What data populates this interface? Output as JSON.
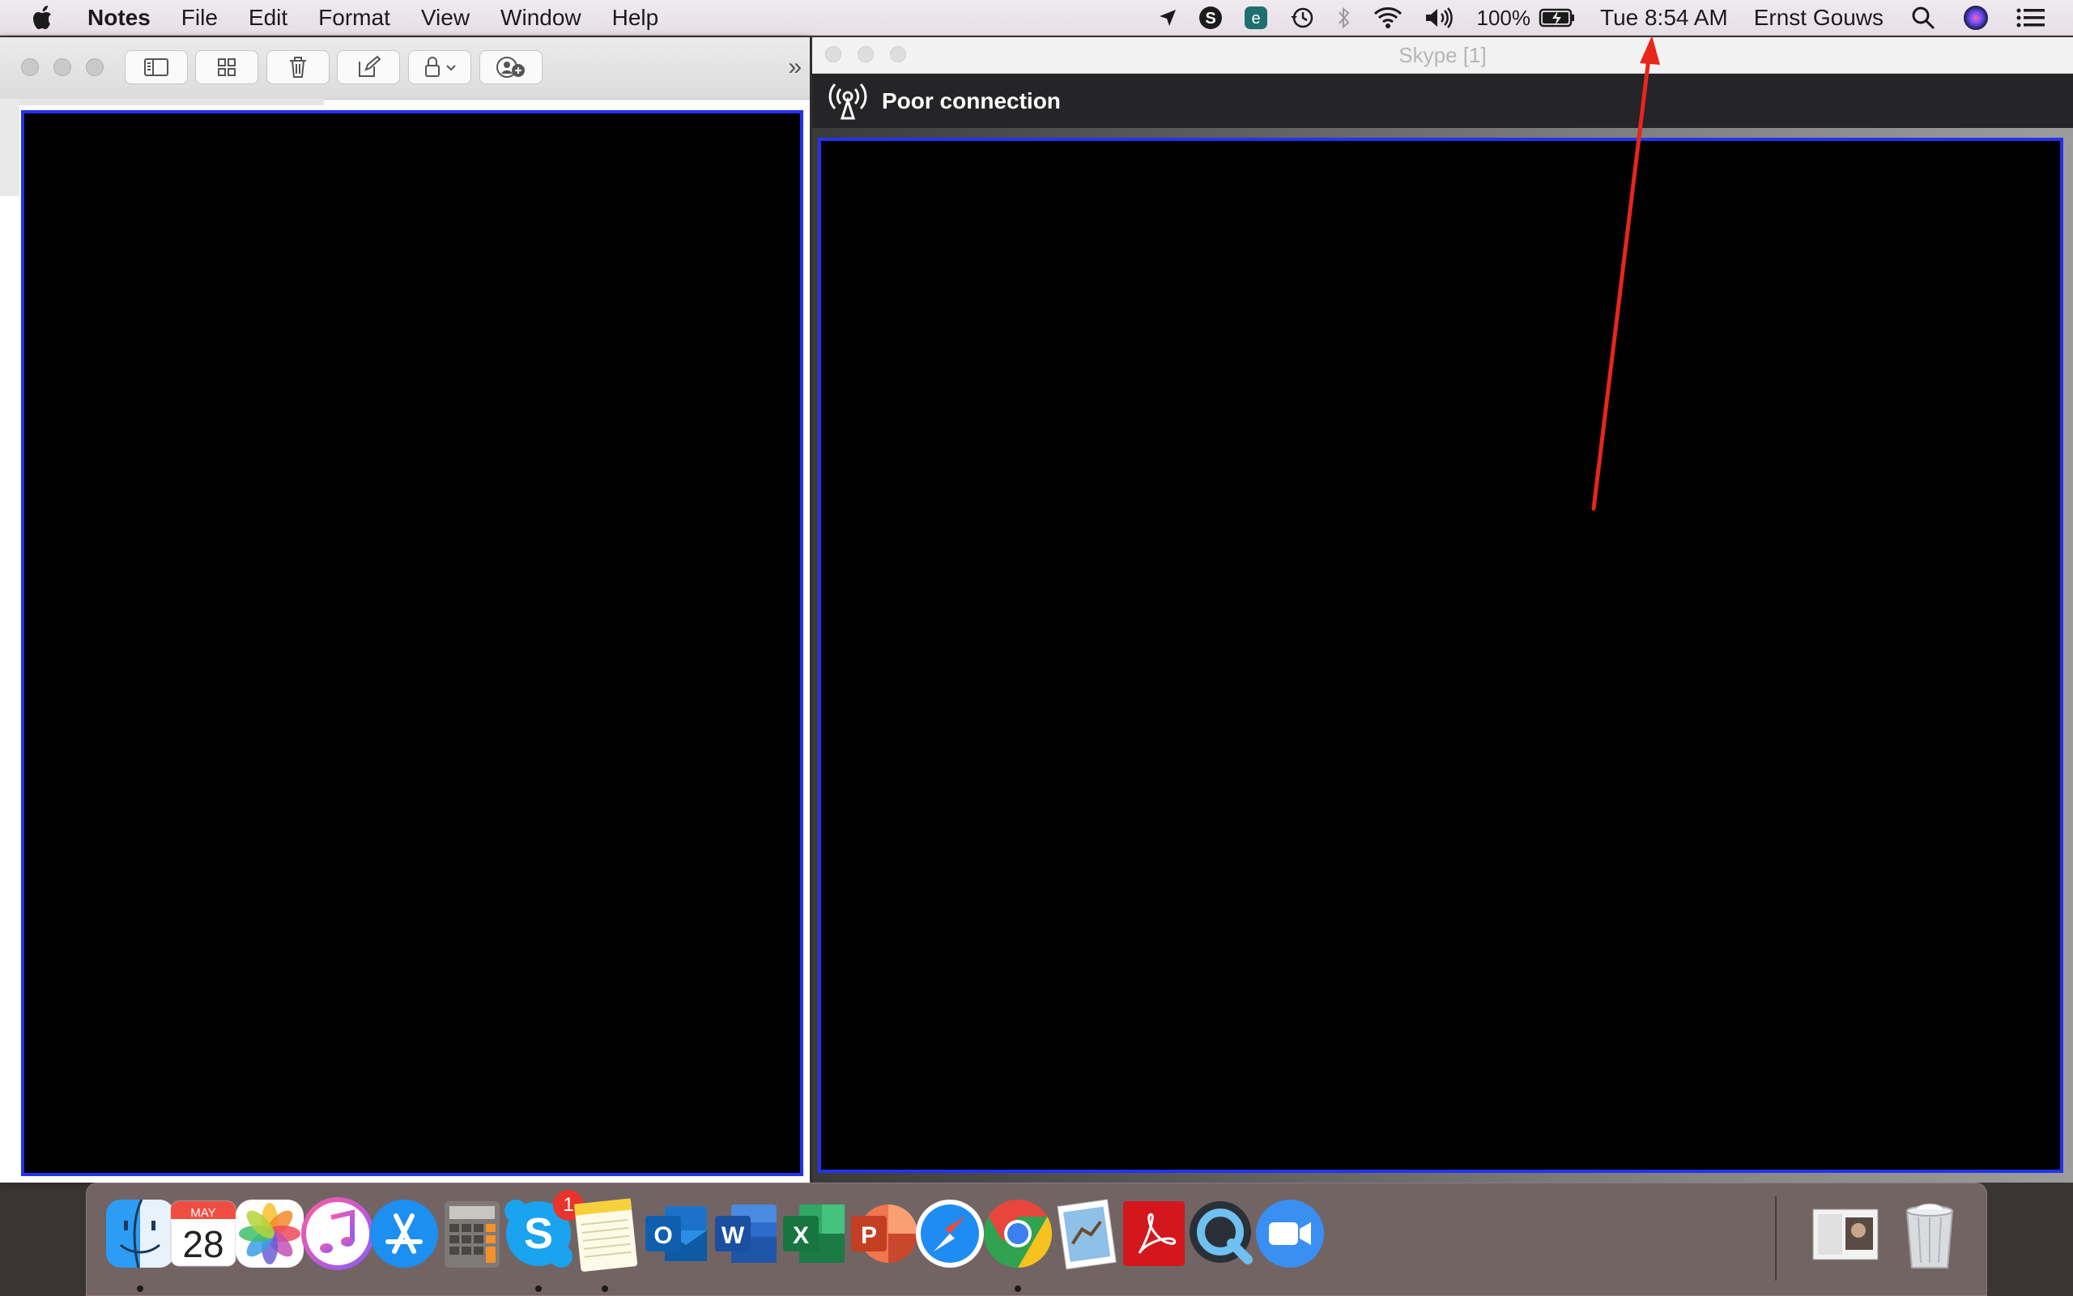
{
  "menubar": {
    "app_name": "Notes",
    "menus": [
      "File",
      "Edit",
      "Format",
      "View",
      "Window",
      "Help"
    ],
    "battery": "100%",
    "clock": "Tue 8:54 AM",
    "user": "Ernst Gouws"
  },
  "notes_window": {
    "toolbar_icons": [
      "sidebar-toggle-icon",
      "gallery-view-icon",
      "trash-icon",
      "compose-icon",
      "lock-icon",
      "add-people-icon"
    ],
    "overflow": "»"
  },
  "skype_window": {
    "title": "Skype [1]",
    "banner": "Poor connection"
  },
  "dock": {
    "calendar_month": "MAY",
    "calendar_day": "28",
    "skype_badge": "1",
    "items": [
      "Finder",
      "Calendar",
      "Photos",
      "iTunes",
      "App Store",
      "Calculator",
      "Skype",
      "Notes",
      "Outlook",
      "Word",
      "Excel",
      "PowerPoint",
      "Safari",
      "Chrome",
      "Preview",
      "Acrobat",
      "QuickTime",
      "Zoom",
      "Downloads",
      "Trash"
    ]
  },
  "colors": {
    "highlight_border": "#2233ee",
    "annotation_arrow": "#e8261c"
  }
}
